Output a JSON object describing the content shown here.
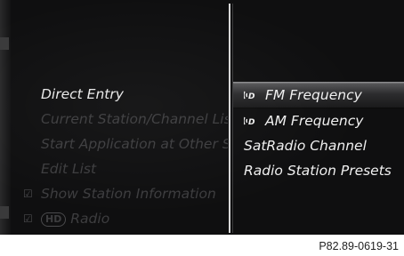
{
  "left_menu": {
    "items": [
      {
        "label": "Direct Entry",
        "checked": false
      },
      {
        "label": "Current Station/Channel List",
        "checked": false
      },
      {
        "label": "Start Application at Other Screen",
        "checked": false
      },
      {
        "label": "Edit List",
        "checked": false
      },
      {
        "label": "Show Station Information",
        "checked": true
      },
      {
        "label": "Radio",
        "checked": true,
        "prefix_icon": "hd-radio-icon",
        "prefix_text": "HD"
      }
    ]
  },
  "right_menu": {
    "items": [
      {
        "label": "FM Frequency",
        "icon": "hd-radio-icon",
        "selected": true
      },
      {
        "label": "AM Frequency",
        "icon": "hd-radio-icon",
        "selected": false
      },
      {
        "label": "SatRadio Channel",
        "icon": null,
        "selected": false
      },
      {
        "label": "Radio Station Presets",
        "icon": null,
        "selected": false
      }
    ]
  },
  "caption": "P82.89-0619-31",
  "colors": {
    "screen_bg": "#0f0f10",
    "active_text": "#e9e9e9",
    "inactive_text": "#3d3d3f",
    "selection_bar": "#5a5a5c"
  }
}
